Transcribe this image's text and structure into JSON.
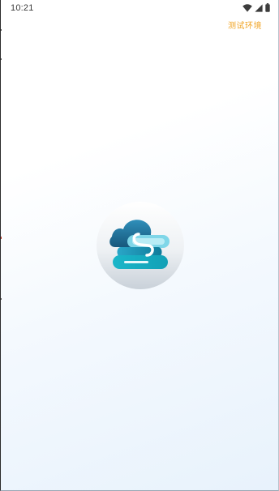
{
  "status_bar": {
    "time": "10:21",
    "icons": [
      "wifi-icon",
      "cellular-signal-icon",
      "battery-icon"
    ]
  },
  "header": {
    "environment_label": "测试环境",
    "environment_label_color": "#f0a424"
  },
  "splash": {
    "logo_icon": "cloud-link-logo-icon",
    "brand_colors": {
      "primary": "#1f7fa8",
      "secondary": "#17b4c6",
      "light": "#7fd6e8"
    }
  }
}
